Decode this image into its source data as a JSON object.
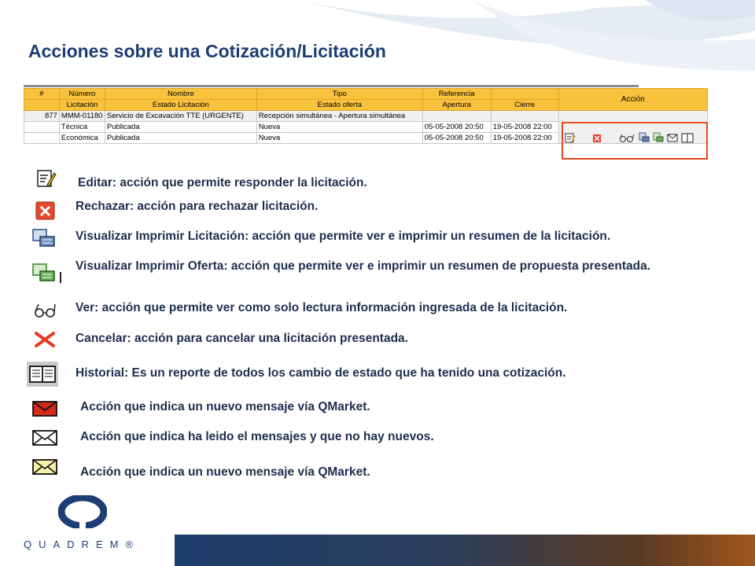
{
  "title": "Acciones sobre una Cotización/Licitación",
  "table": {
    "header_row1": [
      "#",
      "Número",
      "Nombre",
      "Tipo",
      "Referencia",
      ""
    ],
    "header_row2": [
      "",
      "Licitación",
      "Estado Licitación",
      "Estado oferta",
      "Apertura",
      "Cierre"
    ],
    "action_header": "Acción",
    "rows": [
      [
        "877",
        "MMM-01180",
        "Servicio de Excavación TTE (URGENTE)",
        "Recepción simultánea - Apertura simultánea",
        "",
        ""
      ],
      [
        "",
        "Técnica",
        "Publicada",
        "Nueva",
        "05-05-2008 20:50",
        "19-05-2008 22:00"
      ],
      [
        "",
        "Económica",
        "Publicada",
        "Nueva",
        "05-05-2008 20:50",
        "19-05-2008 22:00"
      ]
    ]
  },
  "legend": [
    {
      "icon": "edit-icon",
      "text": "Editar: acción que permite responder la licitación."
    },
    {
      "icon": "reject-icon",
      "text": "Rechazar: acción para rechazar licitación."
    },
    {
      "icon": "view-print-tender-icon",
      "text": "Visualizar Imprimir Licitación: acción que permite ver e imprimir un resumen de la licitación."
    },
    {
      "icon": "view-print-offer-icon",
      "text": "Visualizar Imprimir Oferta: acción que permite ver e imprimir un resumen de propuesta presentada."
    },
    {
      "icon": "glasses-icon",
      "text": "Ver: acción que permite ver como solo lectura información ingresada de la licitación."
    },
    {
      "icon": "cancel-icon",
      "text": "Cancelar: acción para cancelar una licitación presentada."
    },
    {
      "icon": "history-book-icon",
      "text": "Historial: Es un reporte de todos los cambio de estado que ha tenido una cotización."
    },
    {
      "icon": "new-message-red-envelope-icon",
      "text": "Acción que indica un nuevo mensaje  vía QMarket."
    },
    {
      "icon": "read-message-envelope-icon",
      "text": "Acción que indica ha leido el mensajes y que no hay nuevos."
    },
    {
      "icon": "new-message-yellow-envelope-icon",
      "text": "Acción que indica un nuevo mensaje  vía QMarket."
    }
  ],
  "logo": {
    "word": "QUADREM®"
  },
  "colors": {
    "title": "#1d3d74",
    "header": "#f9c23c",
    "highlight": "#e84a1e",
    "text": "#1f2e4f"
  }
}
